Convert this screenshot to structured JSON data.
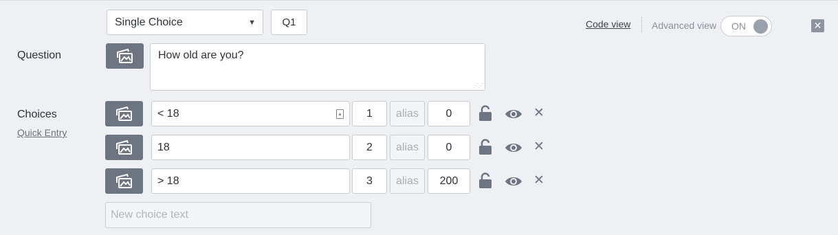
{
  "header": {
    "question_type": "Single Choice",
    "question_id": "Q1",
    "code_view_label": "Code view",
    "advanced_view_label": "Advanced view",
    "toggle_state": "ON"
  },
  "question": {
    "label": "Question",
    "text": "How old are you?"
  },
  "choices_section": {
    "label": "Choices",
    "quick_entry_label": "Quick Entry",
    "items": [
      {
        "text": "< 18",
        "code": "1",
        "alias_placeholder": "alias",
        "value": "0"
      },
      {
        "text": "18",
        "code": "2",
        "alias_placeholder": "alias",
        "value": "0"
      },
      {
        "text": "> 18",
        "code": "3",
        "alias_placeholder": "alias",
        "value": "200"
      }
    ],
    "new_choice_placeholder": "New choice text"
  },
  "colors": {
    "background": "#eef0f4",
    "icon_button": "#6d7583",
    "border": "#c8ccd3"
  }
}
